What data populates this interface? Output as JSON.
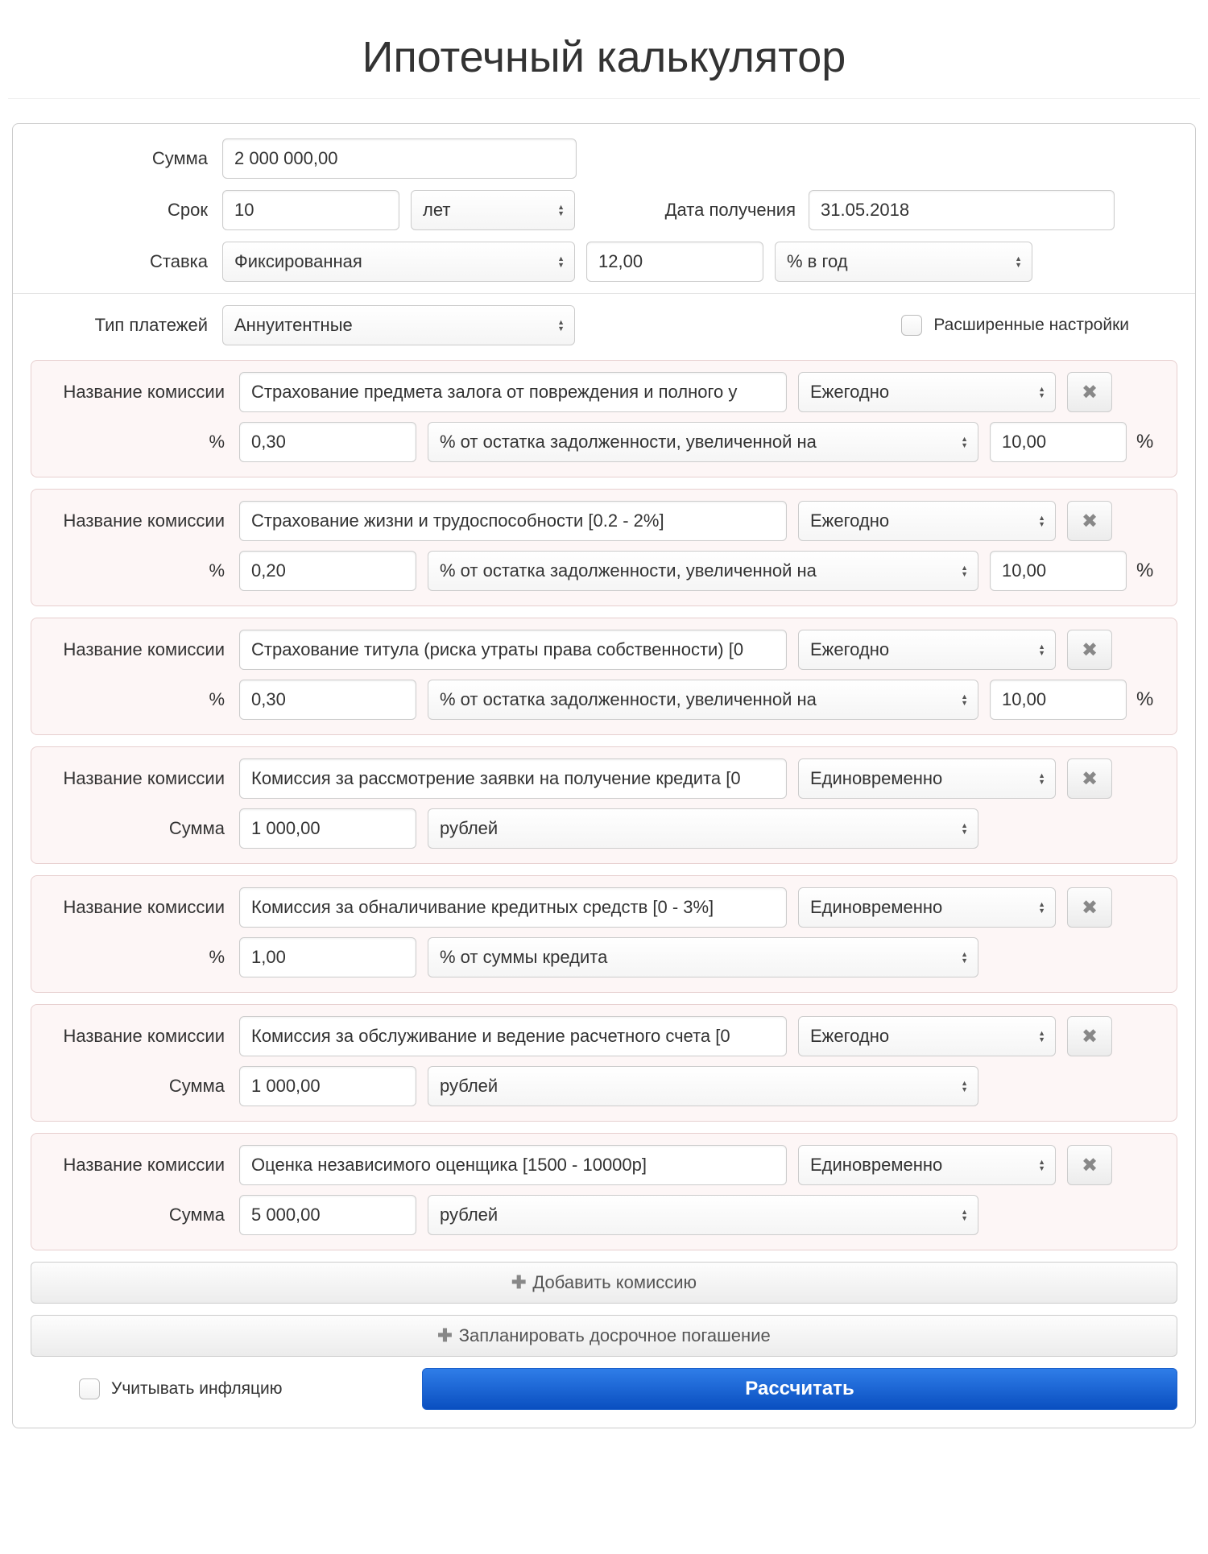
{
  "title": "Ипотечный калькулятор",
  "labels": {
    "amount": "Сумма",
    "term": "Срок",
    "receipt_date": "Дата получения",
    "rate": "Ставка",
    "payment_type": "Тип платежей",
    "advanced": "Расширенные настройки",
    "commission_name": "Название комиссии",
    "percent": "%",
    "sum": "Сумма",
    "add_commission": "Добавить комиссию",
    "plan_early": "Запланировать досрочное погашение",
    "inflation": "Учитывать инфляцию",
    "calculate": "Рассчитать"
  },
  "main": {
    "amount": "2 000 000,00",
    "term_value": "10",
    "term_unit": "лет",
    "receipt_date": "31.05.2018",
    "rate_type": "Фиксированная",
    "rate_value": "12,00",
    "rate_unit": "% в год",
    "payment_type": "Аннуитентные"
  },
  "percent_sign": "%",
  "commissions": [
    {
      "name": "Страхование предмета залога от повреждения и полного у",
      "freq": "Ежегодно",
      "value_label": "%",
      "value": "0,30",
      "basis": "% от остатка задолженности, увеличенной на",
      "extra": "10,00",
      "show_extra_pct": true
    },
    {
      "name": "Страхование жизни и трудоспособности [0.2 - 2%]",
      "freq": "Ежегодно",
      "value_label": "%",
      "value": "0,20",
      "basis": "% от остатка задолженности, увеличенной на",
      "extra": "10,00",
      "show_extra_pct": true
    },
    {
      "name": "Страхование титула (риска утраты права собственности) [0",
      "freq": "Ежегодно",
      "value_label": "%",
      "value": "0,30",
      "basis": "% от остатка задолженности, увеличенной на",
      "extra": "10,00",
      "show_extra_pct": true
    },
    {
      "name": "Комиссия за рассмотрение заявки на получение кредита [0",
      "freq": "Единовременно",
      "value_label": "Сумма",
      "value": "1 000,00",
      "basis": "рублей",
      "extra": "",
      "show_extra_pct": false
    },
    {
      "name": "Комиссия за обналичивание кредитных средств [0 - 3%]",
      "freq": "Единовременно",
      "value_label": "%",
      "value": "1,00",
      "basis": "% от суммы кредита",
      "extra": "",
      "show_extra_pct": false
    },
    {
      "name": "Комиссия за обслуживание и ведение расчетного счета [0 ",
      "freq": "Ежегодно",
      "value_label": "Сумма",
      "value": "1 000,00",
      "basis": "рублей",
      "extra": "",
      "show_extra_pct": false
    },
    {
      "name": "Оценка независимого оценщика [1500 - 10000р]",
      "freq": "Единовременно",
      "value_label": "Сумма",
      "value": "5 000,00",
      "basis": "рублей",
      "extra": "",
      "show_extra_pct": false
    }
  ]
}
